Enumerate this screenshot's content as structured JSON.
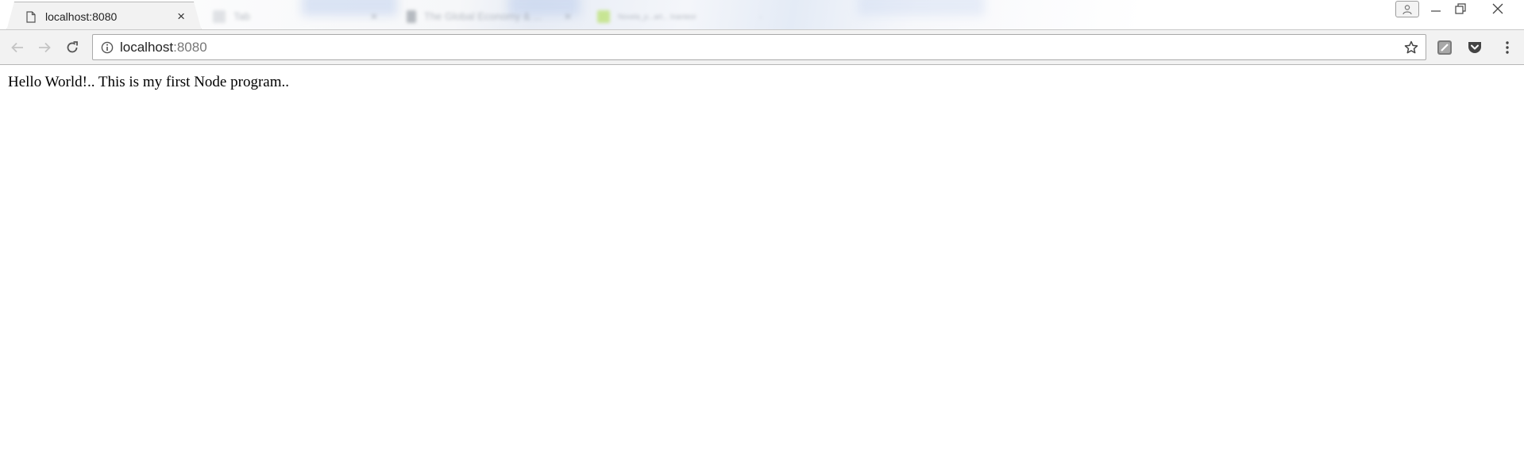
{
  "browser": {
    "active_tab": {
      "title": "localhost:8080",
      "icon": "page-icon",
      "close_glyph": "×"
    },
    "background_tabs": [
      {
        "title": "Tab",
        "icon": "blank-favicon",
        "favicon_color": "#d4d7dc"
      },
      {
        "title": "The Global Economy & ...",
        "icon": "document-favicon",
        "favicon_color": "#9aa0a8"
      },
      {
        "title": "Novela_p...art... Inanteor",
        "icon": "sheet-favicon",
        "favicon_color": "#b8e06a"
      }
    ],
    "window_controls": {
      "profile_icon": "person-icon",
      "minimize_icon": "minimize-icon",
      "maximize_icon": "restore-icon",
      "close_icon": "close-icon"
    },
    "toolbar": {
      "back_icon": "arrow-left-icon",
      "forward_icon": "arrow-right-icon",
      "reload_icon": "reload-icon",
      "site_info_icon": "info-icon",
      "url_host": "localhost",
      "url_port": ":8080",
      "bookmark_icon": "star-icon",
      "extensions": [
        "extension-icon",
        "pocket-icon"
      ],
      "menu_icon": "kebab-menu-icon"
    },
    "colors": {
      "chrome_bg": "#f2f2f2",
      "border": "#b7b7b7",
      "pocket": "#444444"
    }
  },
  "page": {
    "body_text": "Hello World!.. This is my first Node program.."
  }
}
